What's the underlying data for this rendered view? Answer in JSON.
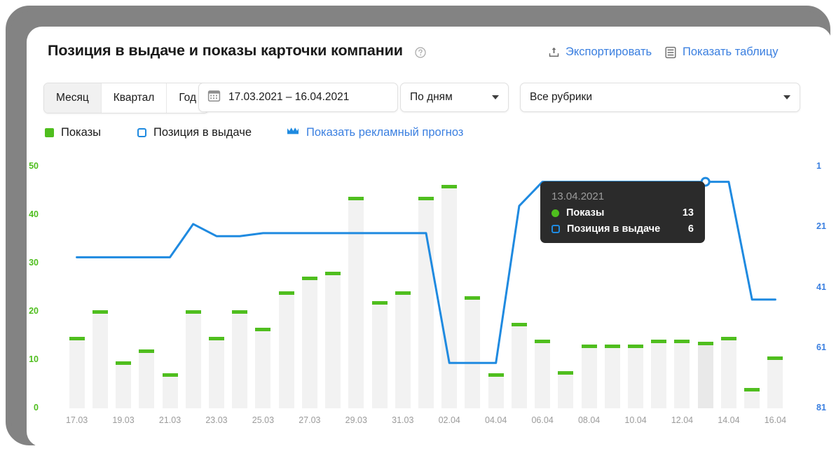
{
  "header": {
    "title": "Позиция в выдаче и показы карточки компании",
    "help_icon": "question-circle-icon",
    "export_label": "Экспортировать",
    "export_icon": "upload-icon",
    "table_label": "Показать таблицу",
    "table_icon": "table-icon"
  },
  "controls": {
    "period_segments": [
      {
        "label": "Месяц",
        "active": true
      },
      {
        "label": "Квартал",
        "active": false
      },
      {
        "label": "Год",
        "active": false
      }
    ],
    "date_range": "17.03.2021 – 16.04.2021",
    "calendar_icon": "calendar-icon",
    "granularity": "По дням",
    "rubrics": "Все рубрики"
  },
  "legend": {
    "shows": "Показы",
    "position": "Позиция в выдаче",
    "forecast": "Показать рекламный прогноз",
    "forecast_icon": "crown-icon"
  },
  "tooltip": {
    "date": "13.04.2021",
    "shows_label": "Показы",
    "shows_value": "13",
    "position_label": "Позиция в выдаче",
    "position_value": "6"
  },
  "colors": {
    "green": "#4fbe1e",
    "blue": "#1f8ae0",
    "link": "#3a7fe0",
    "bar": "#f2f2f2",
    "tooltip_bg": "#2b2b2b"
  },
  "chart_data": {
    "type": "bar",
    "title": "Позиция в выдаче и показы карточки компании",
    "xlabel": "",
    "ylabel": "Показы",
    "y2label": "Позиция в выдаче",
    "ylim": [
      0,
      50
    ],
    "y2lim": [
      1,
      81
    ],
    "y2_inverted": true,
    "grid": false,
    "legend_position": "top-left",
    "yticks": [
      "0",
      "10",
      "20",
      "30",
      "40",
      "50"
    ],
    "y2ticks": [
      "1",
      "21",
      "41",
      "61",
      "81"
    ],
    "x": [
      "17.03",
      "18.03",
      "19.03",
      "20.03",
      "21.03",
      "22.03",
      "23.03",
      "24.03",
      "25.03",
      "26.03",
      "27.03",
      "28.03",
      "29.03",
      "30.03",
      "31.03",
      "01.04",
      "02.04",
      "03.04",
      "04.04",
      "05.04",
      "06.04",
      "07.04",
      "08.04",
      "09.04",
      "10.04",
      "11.04",
      "12.04",
      "13.04",
      "14.04",
      "15.04",
      "16.04"
    ],
    "xtick_labels": [
      "17.03",
      "19.03",
      "21.03",
      "23.03",
      "25.03",
      "27.03",
      "29.03",
      "31.03",
      "02.04",
      "04.04",
      "06.04",
      "08.04",
      "10.04",
      "12.04",
      "14.04",
      "16.04"
    ],
    "series": [
      {
        "name": "Показы",
        "type": "bar",
        "axis": "left",
        "color": "#4fbe1e",
        "values": [
          14,
          19.5,
          9,
          11.5,
          6.5,
          19.5,
          14,
          19.5,
          16,
          23.5,
          26.5,
          27.5,
          43,
          21.5,
          23.5,
          43,
          45.5,
          22.5,
          6.5,
          17,
          13.5,
          7,
          12.5,
          12.5,
          12.5,
          13.5,
          13.5,
          13,
          14,
          3.5,
          10
        ]
      },
      {
        "name": "Позиция в выдаче",
        "type": "line",
        "axis": "right",
        "color": "#1f8ae0",
        "values": [
          31,
          31,
          31,
          31,
          31,
          20,
          24,
          24,
          23,
          23,
          23,
          23,
          23,
          23,
          23,
          23,
          66,
          66,
          66,
          14,
          6,
          6,
          6,
          6,
          6,
          6,
          6,
          6,
          6,
          45,
          45
        ],
        "marker_index": 27
      }
    ],
    "annotations": [
      {
        "type": "tooltip",
        "x": "13.04.2021",
        "shows": 13,
        "position": 6
      }
    ]
  }
}
